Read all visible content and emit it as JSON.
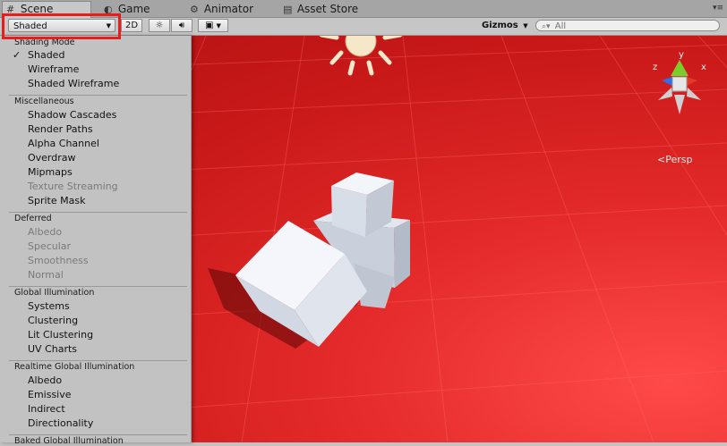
{
  "tabs": [
    {
      "icon": "#",
      "label": "Scene"
    },
    {
      "icon": "◐",
      "label": "Game"
    },
    {
      "icon": "⚙",
      "label": "Animator"
    },
    {
      "icon": "▤",
      "label": "Asset Store"
    }
  ],
  "toolbar": {
    "shading_mode_value": "Shaded",
    "btn_2d": "2D",
    "gizmos_label": "Gizmos",
    "search_placeholder": "All"
  },
  "menu": {
    "shading_mode": {
      "header": "Shading Mode",
      "items": [
        "Shaded",
        "Wireframe",
        "Shaded Wireframe"
      ],
      "checked": "Shaded"
    },
    "miscellaneous": {
      "header": "Miscellaneous",
      "items": [
        "Shadow Cascades",
        "Render Paths",
        "Alpha Channel",
        "Overdraw",
        "Mipmaps",
        "Texture Streaming",
        "Sprite Mask"
      ]
    },
    "deferred": {
      "header": "Deferred",
      "items": [
        "Albedo",
        "Specular",
        "Smoothness",
        "Normal"
      ]
    },
    "global_illumination": {
      "header": "Global Illumination",
      "items": [
        "Systems",
        "Clustering",
        "Lit Clustering",
        "UV Charts"
      ]
    },
    "realtime_gi": {
      "header": "Realtime Global Illumination",
      "items": [
        "Albedo",
        "Emissive",
        "Indirect",
        "Directionality"
      ]
    },
    "baked_gi": {
      "header": "Baked Global Illumination"
    }
  },
  "gizmo": {
    "y": "y",
    "x": "x",
    "z": "z",
    "projection": "Persp"
  },
  "colors": {
    "highlight": "#e81d1d",
    "ground": "#c81818",
    "cube": "#e8edf5"
  }
}
